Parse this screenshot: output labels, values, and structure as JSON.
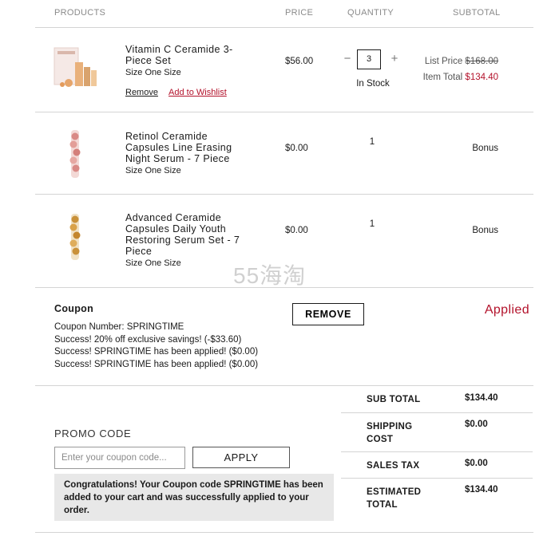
{
  "headers": {
    "products": "PRODUCTS",
    "price": "PRICE",
    "quantity": "QUANTITY",
    "subtotal": "SUBTOTAL"
  },
  "items": [
    {
      "name": "Vitamin C Ceramide 3-Piece Set",
      "size": "Size One Size",
      "price": "$56.00",
      "quantity": "3",
      "stock": "In Stock",
      "list_price_label": "List Price",
      "list_price": "$168.00",
      "item_total_label": "Item Total",
      "item_total": "$134.40",
      "remove": "Remove",
      "wishlist": "Add to Wishlist",
      "qty_minus": "−",
      "qty_plus": "+"
    },
    {
      "name": "Retinol Ceramide Capsules Line Erasing Night Serum - 7 Piece",
      "size": "Size One Size",
      "price": "$0.00",
      "quantity": "1",
      "subtotal": "Bonus"
    },
    {
      "name": "Advanced Ceramide Capsules Daily Youth Restoring Serum Set - 7 Piece",
      "size": "Size One Size",
      "price": "$0.00",
      "quantity": "1",
      "subtotal": "Bonus"
    }
  ],
  "coupon": {
    "title": "Coupon",
    "lines": [
      "Coupon Number: SPRINGTIME",
      "Success! 20% off exclusive savings! (-$33.60)",
      "Success! SPRINGTIME has been applied! ($0.00)",
      "Success! SPRINGTIME has been applied! ($0.00)"
    ],
    "remove_label": "REMOVE",
    "status": "Applied"
  },
  "promo": {
    "label": "PROMO CODE",
    "placeholder": "Enter your coupon code...",
    "apply_label": "APPLY",
    "message": "Congratulations! Your Coupon code SPRINGTIME has been added to your cart and was successfully applied to your order."
  },
  "totals": [
    {
      "label": "SUB TOTAL",
      "value": "$134.40"
    },
    {
      "label": "SHIPPING COST",
      "value": "$0.00"
    },
    {
      "label": "SALES TAX",
      "value": "$0.00"
    },
    {
      "label": "ESTIMATED TOTAL",
      "value": "$134.40"
    }
  ],
  "watermark": "55海淘",
  "colors": {
    "accent": "#b3122b",
    "border": "#d4d4d4",
    "message_bg": "#e8e8e8"
  }
}
